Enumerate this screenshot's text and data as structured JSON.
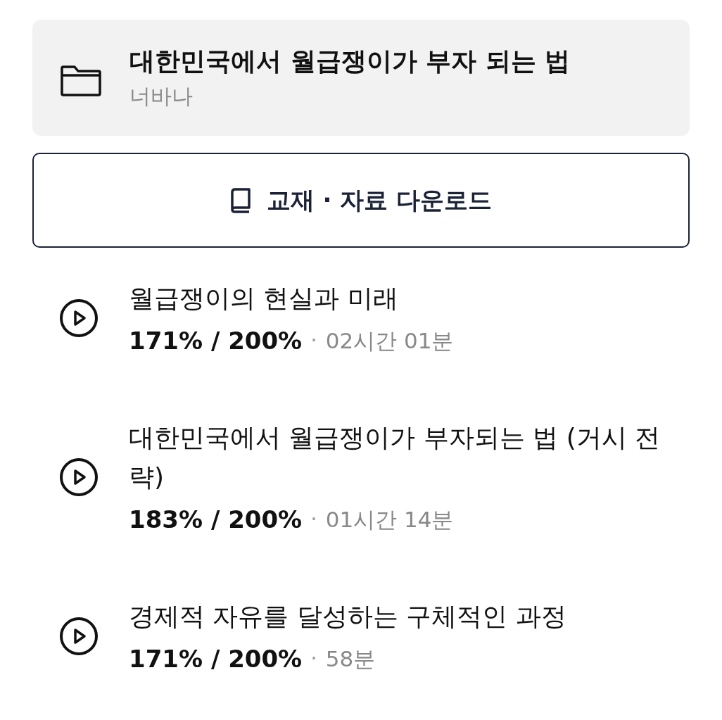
{
  "course": {
    "title": "대한민국에서 월급쟁이가 부자 되는 법",
    "author": "너바나"
  },
  "download_button": {
    "label": "교재 · 자료 다운로드"
  },
  "lessons": [
    {
      "title": "월급쟁이의 현실과 미래",
      "progress": "171% / 200%",
      "separator": "·",
      "duration": "02시간 01분"
    },
    {
      "title": "대한민국에서 월급쟁이가 부자되는 법 (거시 전략)",
      "progress": "183% / 200%",
      "separator": "·",
      "duration": "01시간 14분"
    },
    {
      "title": "경제적 자유를 달성하는 구체적인 과정",
      "progress": "171% / 200%",
      "separator": "·",
      "duration": "58분"
    }
  ]
}
